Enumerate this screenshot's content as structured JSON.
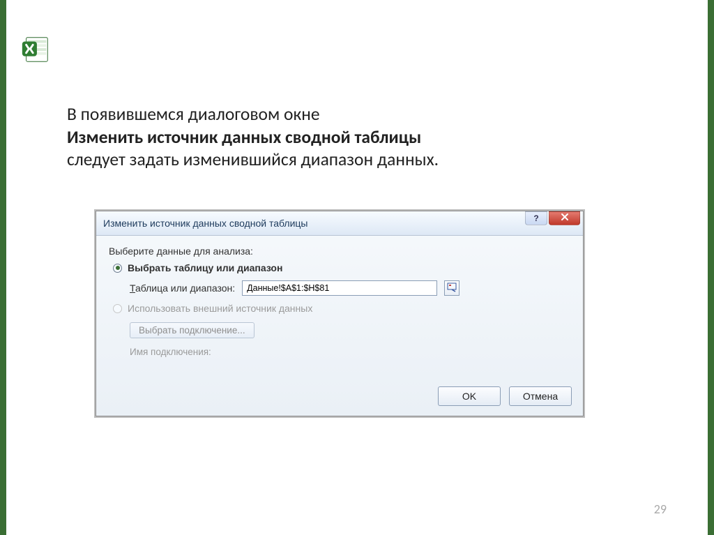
{
  "slide": {
    "text_line1": "В появившемся диалоговом окне",
    "text_bold": "Изменить источник данных сводной таблицы",
    "text_line2": "следует задать изменившийся диапазон данных.",
    "page_number": "29"
  },
  "dialog": {
    "title": "Изменить источник данных сводной таблицы",
    "help_glyph": "?",
    "section_label": "Выберите данные для анализа:",
    "radio1": {
      "label": "Выбрать таблицу или диапазон",
      "selected": true
    },
    "field": {
      "label_prefix": "Т",
      "label_rest": "аблица или диапазон:",
      "value": "Данные!$A$1:$H$81"
    },
    "radio2": {
      "label": "Использовать внешний источник данных"
    },
    "choose_connection_btn": "Выбрать подключение...",
    "connection_name_label": "Имя подключения:",
    "ok_label": "OK",
    "cancel_label": "Отмена"
  }
}
